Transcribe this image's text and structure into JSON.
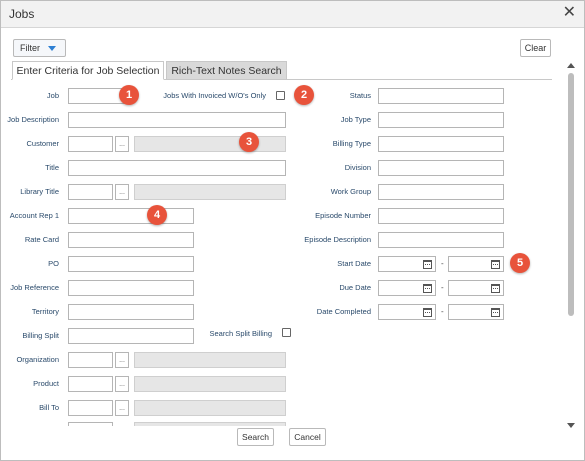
{
  "window": {
    "title": "Jobs",
    "close_glyph": "✕"
  },
  "toolbar": {
    "filter_label": "Filter",
    "clear_label": "Clear"
  },
  "tabs": [
    {
      "label": "Enter Criteria for Job Selection",
      "active": true
    },
    {
      "label": "Rich-Text Notes Search",
      "active": false
    }
  ],
  "left_fields": {
    "job": "Job",
    "job_description": "Job Description",
    "customer": "Customer",
    "title": "Title",
    "library_title": "Library Title",
    "account_rep": "Account Rep 1",
    "rate_card": "Rate Card",
    "po": "PO",
    "job_reference": "Job Reference",
    "territory": "Territory",
    "billing_split": "Billing Split",
    "organization": "Organization",
    "product": "Product",
    "bill_to": "Bill To"
  },
  "middle_fields": {
    "jobs_invoiced": "Jobs With Invoiced W/O's Only",
    "search_split_billing": "Search Split Billing"
  },
  "right_fields": {
    "status": "Status",
    "job_type": "Job Type",
    "billing_type": "Billing Type",
    "division": "Division",
    "work_group": "Work Group",
    "episode_number": "Episode Number",
    "episode_description": "Episode Description",
    "start_date": "Start Date",
    "due_date": "Due Date",
    "date_completed": "Date Completed"
  },
  "browse_glyph": "...",
  "date_separator": "-",
  "markers": [
    "1",
    "2",
    "3",
    "4",
    "5"
  ],
  "buttons": {
    "search": "Search",
    "cancel": "Cancel"
  },
  "colors": {
    "marker": "#e8533b",
    "label": "#2a4a6b",
    "filter_caret": "#2d7fd3"
  }
}
